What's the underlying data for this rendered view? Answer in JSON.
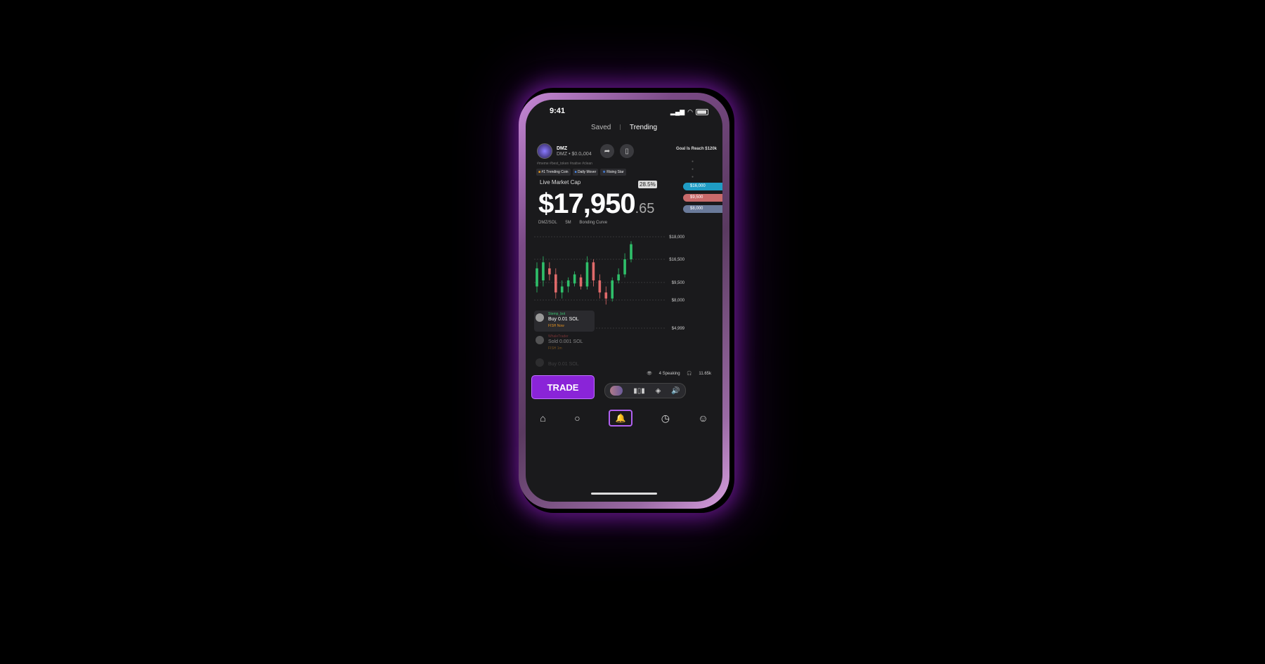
{
  "status": {
    "time": "9:41"
  },
  "top_tabs": {
    "saved": "Saved",
    "trending": "Trending"
  },
  "token": {
    "name": "DMZ",
    "sub": "DMZ • $0.0₀004",
    "hashtags": "#meme #best_token #native #clean"
  },
  "goal": "Goal Is Reach $120k",
  "badges": [
    "#1 Trending Coin",
    "Daily Mover",
    "Rising Star"
  ],
  "market": {
    "label": "Live Market Cap",
    "price_main": "$17,950",
    "price_cents": ".65",
    "change": "28.5%"
  },
  "pair": {
    "pair": "DMZ/SOL",
    "interval": "5M",
    "curve": "Bonding Curve"
  },
  "levels": [
    {
      "label": "$16,000",
      "color": "#1f9cc4"
    },
    {
      "label": "$9,500",
      "color": "#c86a6a"
    },
    {
      "label": "$8,000",
      "color": "#6a7a9a"
    }
  ],
  "chart_data": {
    "type": "candlestick",
    "y_tick_labels": [
      "$18,000",
      "$16,500",
      "$9,500",
      "$8,000",
      "$4,999"
    ],
    "candles": [
      {
        "o": 11,
        "c": 14,
        "h": 15,
        "l": 10
      },
      {
        "o": 12,
        "c": 15,
        "h": 16,
        "l": 11
      },
      {
        "o": 14,
        "c": 13,
        "h": 15,
        "l": 12
      },
      {
        "o": 13,
        "c": 10,
        "h": 14,
        "l": 9
      },
      {
        "o": 10,
        "c": 11,
        "h": 12,
        "l": 9
      },
      {
        "o": 11,
        "c": 12,
        "h": 12.5,
        "l": 10
      },
      {
        "o": 11.5,
        "c": 13,
        "h": 13.5,
        "l": 11
      },
      {
        "o": 12.5,
        "c": 11,
        "h": 13,
        "l": 10.5
      },
      {
        "o": 11,
        "c": 15,
        "h": 16,
        "l": 10.5
      },
      {
        "o": 15,
        "c": 12,
        "h": 15.5,
        "l": 11
      },
      {
        "o": 12,
        "c": 10,
        "h": 13,
        "l": 9
      },
      {
        "o": 10,
        "c": 9,
        "h": 11,
        "l": 8
      },
      {
        "o": 9,
        "c": 12,
        "h": 12.5,
        "l": 8.5
      },
      {
        "o": 12,
        "c": 13,
        "h": 14,
        "l": 11.5
      },
      {
        "o": 13,
        "c": 15.5,
        "h": 16.5,
        "l": 12.5
      },
      {
        "o": 15.5,
        "c": 18,
        "h": 18.5,
        "l": 15
      }
    ]
  },
  "feed": [
    {
      "user": "Stemp_bot",
      "action": "Buy 0.01 SOL",
      "tag": "FISH Now"
    },
    {
      "user": "WhaleTrader",
      "action": "Sold 0.001 SOL",
      "tag": "FISH 1m"
    },
    {
      "user": "anon",
      "action": "Buy 0.01 SOL",
      "tag": ""
    }
  ],
  "social": {
    "speaking": "4 Speaking",
    "listeners": "11.65k"
  },
  "trade_label": "TRADE"
}
